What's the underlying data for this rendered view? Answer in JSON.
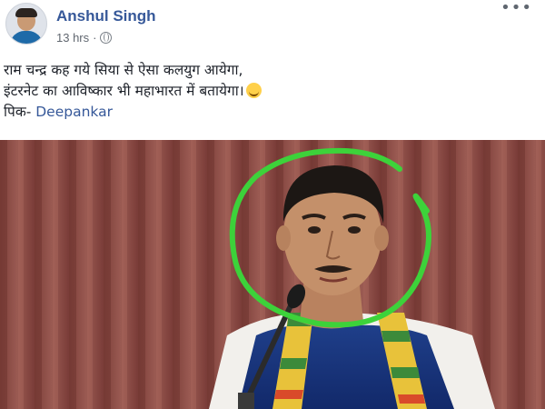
{
  "post": {
    "author": "Anshul Singh",
    "time": "13 hrs",
    "separator": "·",
    "privacy_icon": "globe-icon",
    "menu_icon": "more-dots-icon",
    "text_line_1": "राम चन्द्र कह गये सिया से ऐसा कलयुग आयेगा,",
    "text_line_2": "इंटरनेट का आविष्कार भी महाभारत में बतायेगा।",
    "emoji": "laughing-face-icon",
    "credit_prefix": "पिक- ",
    "credit_tag": "Deepankar",
    "menu_glyph": "•••"
  },
  "colors": {
    "author": "#365899",
    "tag": "#365899",
    "circle": "#3dd23a",
    "curtain": "#8a4a44"
  }
}
